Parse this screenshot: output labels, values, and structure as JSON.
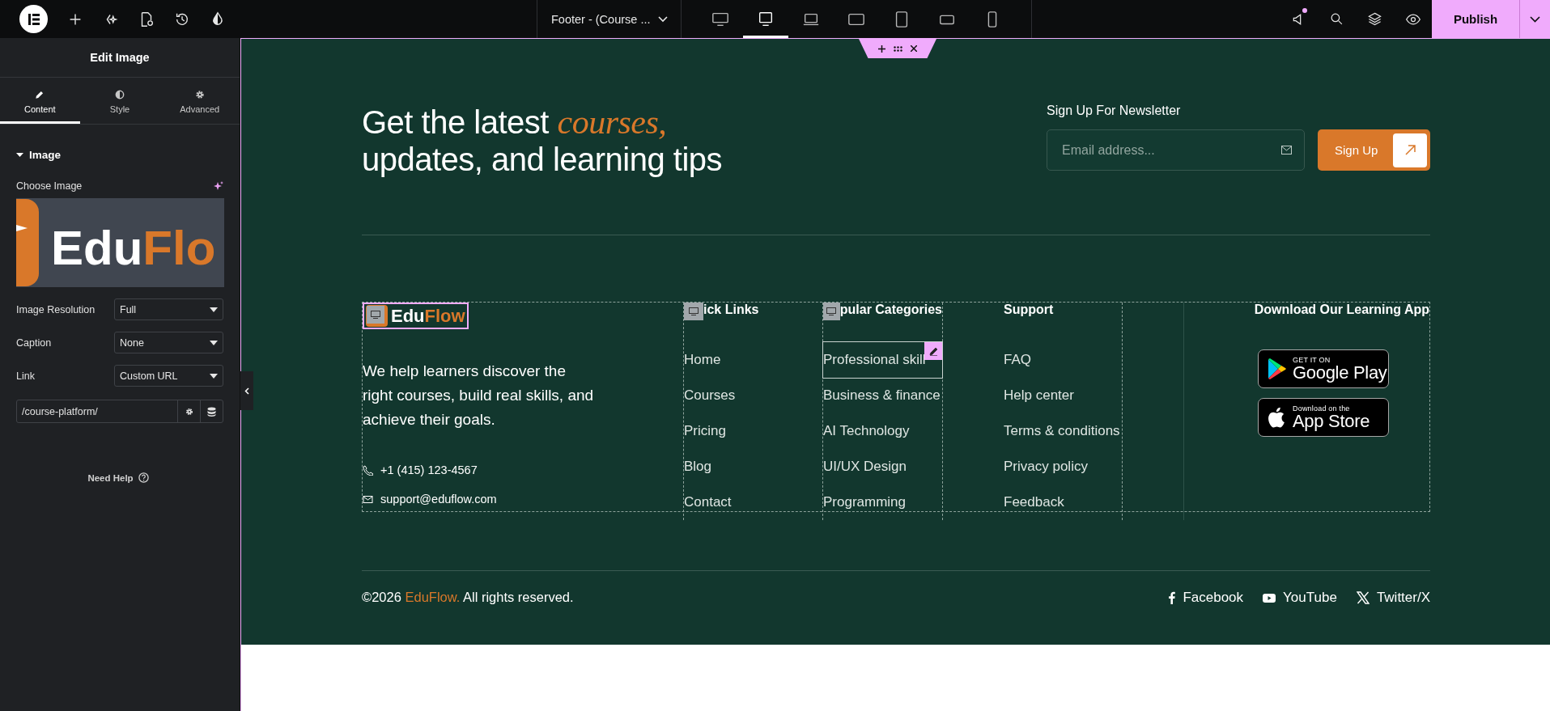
{
  "topbar": {
    "document_title": "Footer - (Course ...",
    "devices": [
      {
        "kind": "widescreen",
        "selected": false
      },
      {
        "kind": "desktop",
        "selected": true
      },
      {
        "kind": "laptop",
        "selected": false
      },
      {
        "kind": "tablet-landscape",
        "selected": false
      },
      {
        "kind": "tablet",
        "selected": false
      },
      {
        "kind": "mobile-landscape",
        "selected": false
      },
      {
        "kind": "mobile",
        "selected": false
      }
    ],
    "notification_dot": true,
    "publish": "Publish"
  },
  "panel": {
    "title": "Edit Image",
    "tabs": [
      {
        "label": "Content",
        "kind": "pencil",
        "selected": true
      },
      {
        "label": "Style",
        "kind": "contrast",
        "selected": false
      },
      {
        "label": "Advanced",
        "kind": "gear",
        "selected": false
      }
    ],
    "section": {
      "title": "Image",
      "expanded": true
    },
    "choose_image": "Choose Image",
    "preview_text": [
      "Edu",
      "Flo"
    ],
    "selects": [
      {
        "label": "Image Resolution",
        "value": "Full"
      },
      {
        "label": "Caption",
        "value": "None"
      },
      {
        "label": "Link",
        "value": "Custom URL"
      }
    ],
    "url": "/course-platform/",
    "help": "Need Help"
  },
  "footer": {
    "headline": [
      "Get the latest *courses,*",
      "updates, and learning tips"
    ],
    "newsletter": {
      "label": "Sign Up For Newsletter",
      "placeholder": "Email address...",
      "button": "Sign Up"
    },
    "brand": {
      "logo": [
        "Edu",
        "Flow"
      ],
      "selected": true,
      "description": "We help learners discover the right courses, build real skills, and achieve their goals.",
      "contacts": [
        {
          "kind": "phone",
          "text": "+1 (415) 123-4567"
        },
        {
          "kind": "email",
          "text": "support@eduflow.com"
        }
      ]
    },
    "columns": [
      {
        "heading": "ick Links",
        "links": [
          {
            "label": "Home",
            "selected": false
          },
          {
            "label": "Courses",
            "selected": false
          },
          {
            "label": "Pricing",
            "selected": false
          },
          {
            "label": "Blog",
            "selected": false
          },
          {
            "label": "Contact",
            "selected": false
          }
        ]
      },
      {
        "heading": "pular Categories",
        "links": [
          {
            "label": "Professional skill",
            "selected": true
          },
          {
            "label": "Business & finance",
            "selected": false
          },
          {
            "label": "AI Technology",
            "selected": false
          },
          {
            "label": "UI/UX Design",
            "selected": false
          },
          {
            "label": "Programming",
            "selected": false
          }
        ]
      },
      {
        "heading": "Support",
        "links": [
          {
            "label": "FAQ",
            "selected": false
          },
          {
            "label": "Help center",
            "selected": false
          },
          {
            "label": "Terms & conditions",
            "selected": false
          },
          {
            "label": "Privacy policy",
            "selected": false
          },
          {
            "label": "Feedback",
            "selected": false
          }
        ]
      }
    ],
    "app": {
      "heading": "Download Our Learning App",
      "badges": [
        {
          "kind": "google",
          "small": "GET IT ON",
          "big": "Google Play"
        },
        {
          "kind": "apple",
          "small": "Download on the",
          "big": "App Store"
        }
      ]
    },
    "copyright": {
      "prefix": "©2026",
      "brand": "EduFlow.",
      "suffix": "All rights reserved."
    },
    "socials": [
      {
        "kind": "facebook",
        "label": "Facebook"
      },
      {
        "kind": "youtube",
        "label": "YouTube"
      },
      {
        "kind": "x",
        "label": "Twitter/X"
      }
    ]
  }
}
